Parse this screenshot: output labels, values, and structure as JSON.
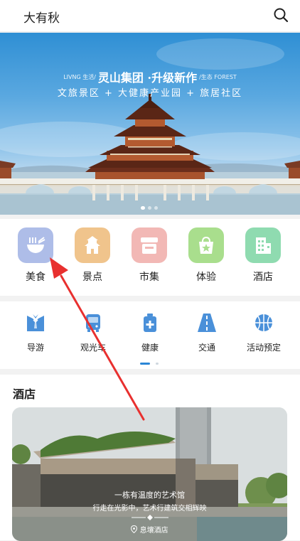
{
  "header": {
    "title": "大有秋",
    "search_icon": "search-icon"
  },
  "banner": {
    "left_tag": "LIVNG 生活/",
    "headline": "灵山集团 ·升级新作",
    "right_tag": "/生态 FOREST",
    "subline": "文旅景区 + 大健康产业园 + 旅居社区",
    "slides": 3,
    "active_slide": 1
  },
  "categories": [
    {
      "label": "美食",
      "icon": "noodle-bowl-icon",
      "color": "#aebde8"
    },
    {
      "label": "景点",
      "icon": "pagoda-icon",
      "color": "#f0c48c"
    },
    {
      "label": "市集",
      "icon": "market-stall-icon",
      "color": "#f2b8b5"
    },
    {
      "label": "体验",
      "icon": "star-bag-icon",
      "color": "#a9de8d"
    },
    {
      "label": "酒店",
      "icon": "hotel-building-icon",
      "color": "#8fdbb0"
    }
  ],
  "services": [
    {
      "label": "导游",
      "icon": "guide-icon"
    },
    {
      "label": "观光车",
      "icon": "bus-icon"
    },
    {
      "label": "健康",
      "icon": "medical-kit-icon"
    },
    {
      "label": "交通",
      "icon": "road-icon"
    },
    {
      "label": "活动预定",
      "icon": "basketball-icon"
    }
  ],
  "hotel": {
    "section_title": "酒店",
    "caption_title": "一栋有温度的艺术馆",
    "caption_sub": "行走在光影中，艺术行建筑交相辉映",
    "name": "息壤酒店",
    "pin_icon": "location-pin-icon"
  },
  "colors": {
    "accent": "#2b86d6",
    "annotation_arrow": "#e8302f"
  }
}
